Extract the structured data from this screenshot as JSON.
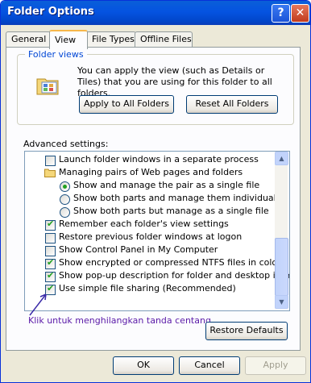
{
  "window": {
    "title": "Folder Options"
  },
  "titlebar": {
    "help_glyph": "?",
    "close_glyph": "✕"
  },
  "tabs": [
    {
      "label": "General"
    },
    {
      "label": "View"
    },
    {
      "label": "File Types"
    },
    {
      "label": "Offline Files"
    }
  ],
  "folder_views": {
    "title": "Folder views",
    "description": "You can apply the view (such as Details or Tiles) that you are using for this folder to all folders.",
    "apply_label": "Apply to All Folders",
    "reset_label": "Reset All Folders"
  },
  "advanced": {
    "label": "Advanced settings:",
    "items": [
      {
        "label": "Launch folder windows in a separate process"
      },
      {
        "label": "Managing pairs of Web pages and folders"
      },
      {
        "label": "Show and manage the pair as a single file"
      },
      {
        "label": "Show both parts and manage them individually"
      },
      {
        "label": "Show both parts but manage as a single file"
      },
      {
        "label": "Remember each folder's view settings"
      },
      {
        "label": "Restore previous folder windows at logon"
      },
      {
        "label": "Show Control Panel in My Computer"
      },
      {
        "label": "Show encrypted or compressed NTFS files in color"
      },
      {
        "label": "Show pop-up description for folder and desktop items"
      },
      {
        "label": "Use simple file sharing (Recommended)"
      }
    ],
    "restore_label": "Restore Defaults"
  },
  "annotation": "Klik untuk menghilangkan tanda centang",
  "footer": {
    "ok_label": "OK",
    "cancel_label": "Cancel",
    "apply_label": "Apply"
  }
}
